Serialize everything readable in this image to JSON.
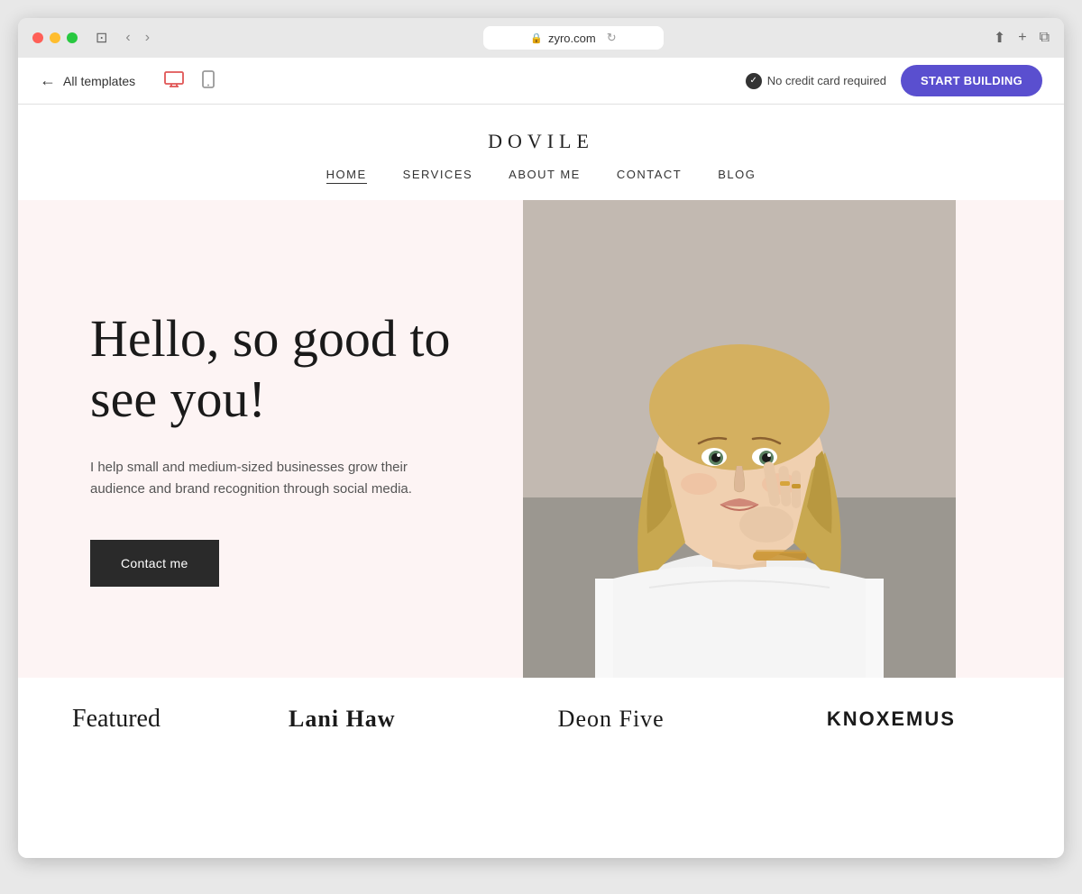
{
  "browser": {
    "url": "zyro.com",
    "refresh_icon": "↻"
  },
  "toolbar": {
    "back_label": "←",
    "all_templates_label": "All templates",
    "no_credit_card_label": "No credit card required",
    "start_building_label": "START BUILDING"
  },
  "site": {
    "logo": "DOVILE",
    "nav": [
      {
        "label": "HOME",
        "active": true
      },
      {
        "label": "SERVICES",
        "active": false
      },
      {
        "label": "ABOUT ME",
        "active": false
      },
      {
        "label": "CONTACT",
        "active": false
      },
      {
        "label": "BLOG",
        "active": false
      }
    ],
    "hero": {
      "heading": "Hello, so good to see you!",
      "subtext": "I help small and medium-sized businesses grow their audience and brand recognition through social media.",
      "cta_label": "Contact me"
    },
    "featured": {
      "label": "Featured",
      "brands": [
        {
          "name": "Lani Haw",
          "style": "bold"
        },
        {
          "name": "Deon Five",
          "style": "light"
        },
        {
          "name": "KNOXEMUS",
          "style": "caps"
        }
      ]
    }
  }
}
